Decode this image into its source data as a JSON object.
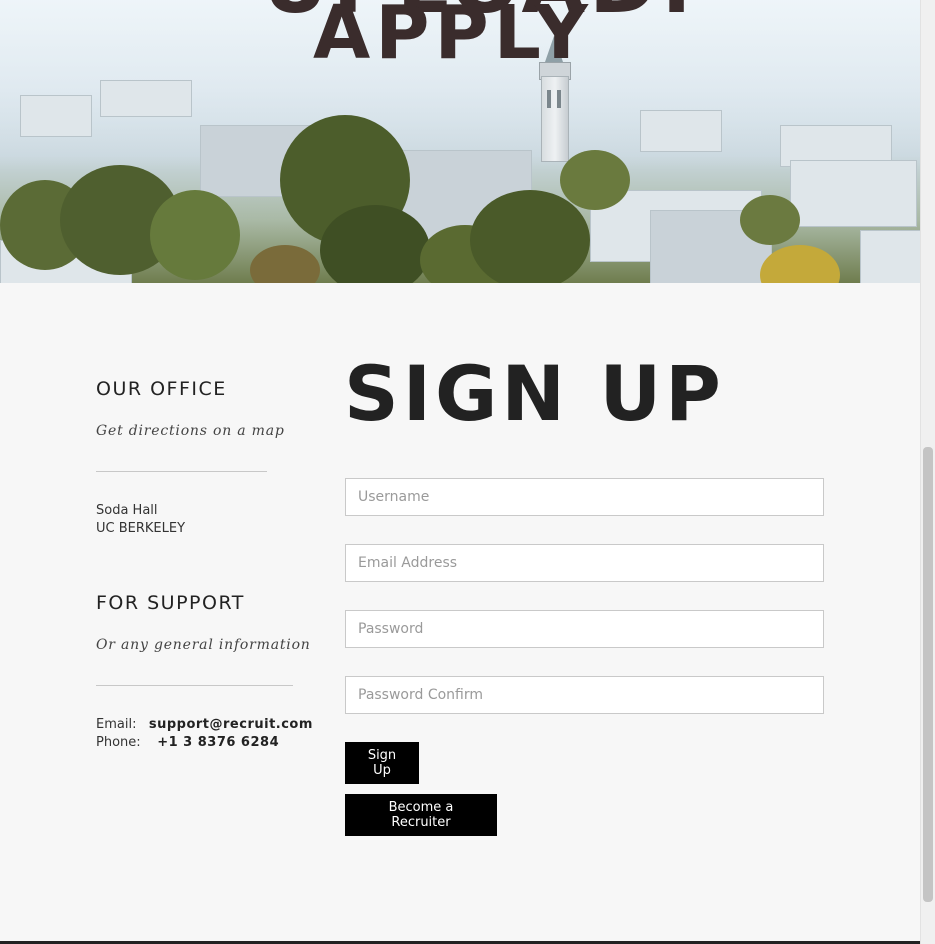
{
  "hero": {
    "headline_top": "UPLOAD.",
    "headline_main": "APPLY"
  },
  "office": {
    "heading": "OUR OFFICE",
    "subheading": "Get directions on a map",
    "address_line1": "Soda Hall",
    "address_line2": "UC BERKELEY"
  },
  "support": {
    "heading": "FOR SUPPORT",
    "subheading": "Or any general information",
    "email_label": "Email:",
    "email_value": "support@recruit.com",
    "phone_label": "Phone:",
    "phone_value": "+1 3 8376 6284"
  },
  "form": {
    "title": "SIGN UP",
    "username_placeholder": "Username",
    "email_placeholder": "Email Address",
    "password_placeholder": "Password",
    "password_confirm_placeholder": "Password Confirm",
    "signup_button": "Sign Up",
    "recruiter_button": "Become a Recruiter"
  },
  "colors": {
    "page_background": "#f7f7f7",
    "button_background": "#000000",
    "button_text": "#ffffff",
    "heading_text": "#222222",
    "hero_headline": "#3a2c2c"
  }
}
